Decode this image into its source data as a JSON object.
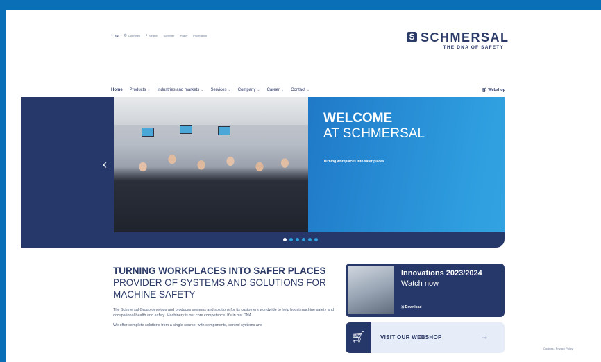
{
  "topbar": {
    "lang": "EN",
    "items": [
      "Countries",
      "Search",
      "Schemer",
      "Policy",
      "Information"
    ]
  },
  "logo": {
    "brand": "SCHMERSAL",
    "tagline": "THE DNA OF SAFETY"
  },
  "nav": {
    "items": [
      "Home",
      "Products",
      "Industries and markets",
      "Services",
      "Company",
      "Career",
      "Contact"
    ],
    "webshop": "Webshop"
  },
  "hero": {
    "title_line1": "WELCOME",
    "title_line2": "AT SCHMERSAL",
    "subtitle": "Turning workplaces into safer places",
    "slides": 6,
    "active_slide": 1
  },
  "content": {
    "heading": "TURNING WORKPLACES INTO SAFER PLACES",
    "subheading": "PROVIDER OF SYSTEMS AND SOLUTIONS FOR MACHINE SAFETY",
    "para1": "The Schmersal Group develops and produces systems and solutions for its customers worldwide to help boost machine safety and occupational health and safety. Machinery is our core competence. It's in our DNA.",
    "para2": "We offer complete solutions from a single source: with components, control systems and"
  },
  "promo": {
    "title": "Innovations 2023/2024",
    "subtitle": "Watch now",
    "download": "Download"
  },
  "shop_button": {
    "label": "VISIT OUR WEBSHOP"
  },
  "footer": {
    "note": "Cookies / Privacy Policy"
  },
  "colors": {
    "navy": "#26386a",
    "blue": "#2f9fe0",
    "page_bg": "#0b6fb8"
  },
  "icons": [
    "globe-icon",
    "search-icon",
    "cart-icon",
    "chevron-left-icon",
    "chevron-right-icon",
    "download-icon",
    "arrow-right-icon"
  ]
}
